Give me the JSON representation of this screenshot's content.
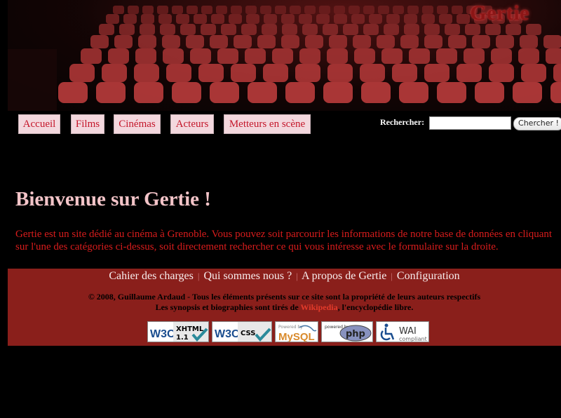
{
  "header": {
    "logo_text": "Gertie"
  },
  "nav": {
    "items": [
      {
        "label": "Accueil"
      },
      {
        "label": "Films"
      },
      {
        "label": "Cinémas"
      },
      {
        "label": "Acteurs"
      },
      {
        "label": "Metteurs en scène"
      }
    ]
  },
  "search": {
    "label": "Rechercher:",
    "value": "",
    "button_label": "Chercher !"
  },
  "main": {
    "title": "Bienvenue sur Gertie !",
    "intro": "Gertie est un site dédié au cinéma à Grenoble. Vous pouvez soit parcourir les informations de notre base de données en cliquant sur l'une des catégories ci-dessus, soit directement rechercher ce qui vous intéresse avec le formulaire sur la droite."
  },
  "footer": {
    "links": [
      {
        "label": "Cahier des charges"
      },
      {
        "label": "Qui sommes nous ?"
      },
      {
        "label": "A propos de Gertie"
      },
      {
        "label": "Configuration"
      }
    ],
    "separator": "|",
    "copyright": "© 2008, Guillaume Ardaud - Tous les éléments présents sur ce site sont la propriété de leurs auteurs respectifs",
    "synopsis_prefix": "Les synopsis et biographies sont tirés de ",
    "synopsis_link": "Wikipedia",
    "synopsis_suffix": ", l'encyclopédie libre.",
    "badges": {
      "xhtml": {
        "brand": "W3C",
        "name": "XHTML",
        "version": "1.1"
      },
      "css": {
        "brand": "W3C",
        "name": "CSS"
      },
      "mysql": {
        "top": "Powered by",
        "name": "MySQL"
      },
      "php": {
        "top": "powered by",
        "name": "php"
      },
      "wai": {
        "name": "WAI",
        "sub": "compliant"
      }
    }
  },
  "colors": {
    "background": "#000000",
    "nav_bg": "#f3d8de",
    "nav_text": "#c4162a",
    "title": "#f3c4c8",
    "intro": "#d81c1c",
    "footer_bg": "#8a1f1b"
  }
}
